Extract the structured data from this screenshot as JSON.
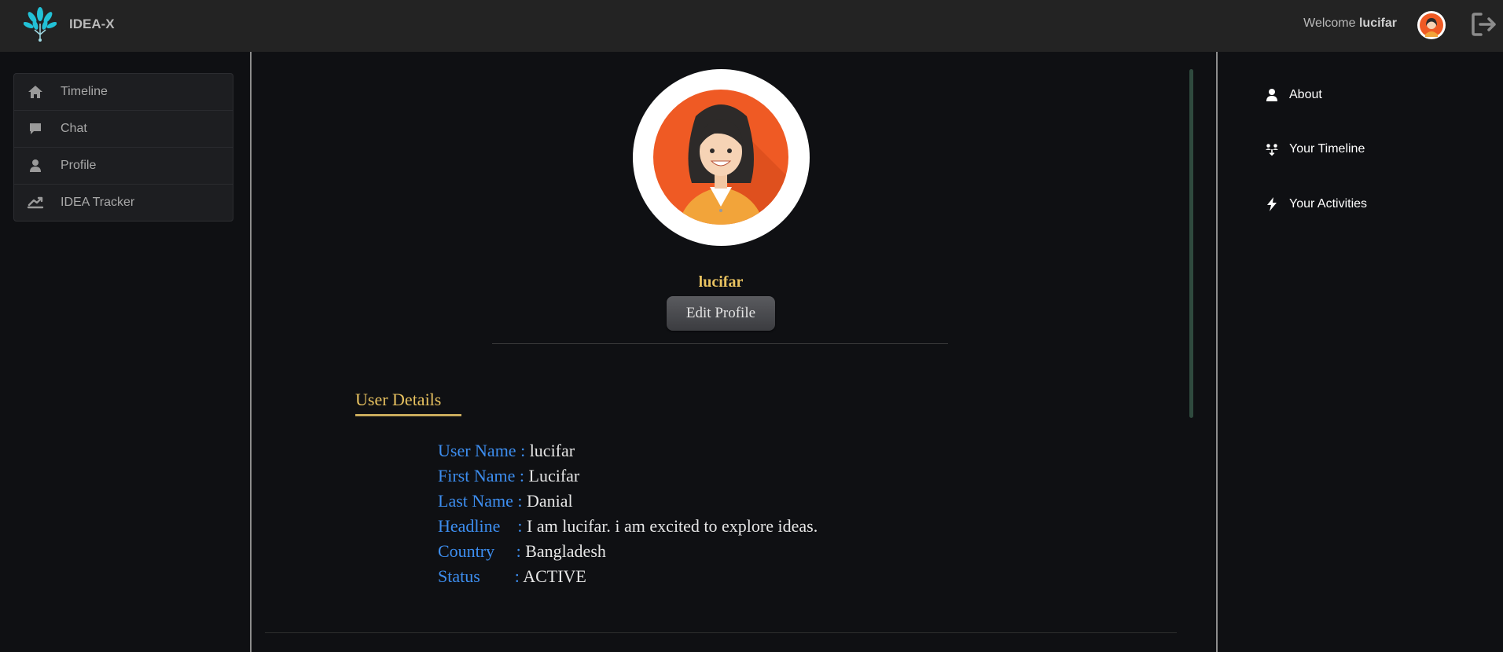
{
  "header": {
    "brand": "IDEA-X",
    "welcome_prefix": "Welcome",
    "welcome_user": "lucifar"
  },
  "sidebar": {
    "items": [
      {
        "label": "Timeline",
        "icon": "home-icon"
      },
      {
        "label": "Chat",
        "icon": "chat-icon"
      },
      {
        "label": "Profile",
        "icon": "user-icon"
      },
      {
        "label": "IDEA Tracker",
        "icon": "tracker-icon"
      }
    ]
  },
  "profile": {
    "username": "lucifar",
    "edit_label": "Edit Profile",
    "section_title": "User Details",
    "details": [
      {
        "key": "User Name : ",
        "value": "lucifar"
      },
      {
        "key": "First Name : ",
        "value": "Lucifar"
      },
      {
        "key": "Last Name : ",
        "value": "Danial"
      },
      {
        "key": "Headline    : ",
        "value": "I am lucifar. i am excited to explore ideas."
      },
      {
        "key": "Country     : ",
        "value": "Bangladesh"
      },
      {
        "key": "Status        : ",
        "value": "ACTIVE"
      }
    ]
  },
  "right_nav": {
    "items": [
      {
        "label": "About",
        "icon": "user-icon"
      },
      {
        "label": "Your Timeline",
        "icon": "people-icon"
      },
      {
        "label": "Your Activities",
        "icon": "bolt-icon"
      }
    ]
  },
  "colors": {
    "accent_gold": "#e8c260",
    "label_blue": "#3d8ef0",
    "avatar_orange": "#ef5a24"
  }
}
